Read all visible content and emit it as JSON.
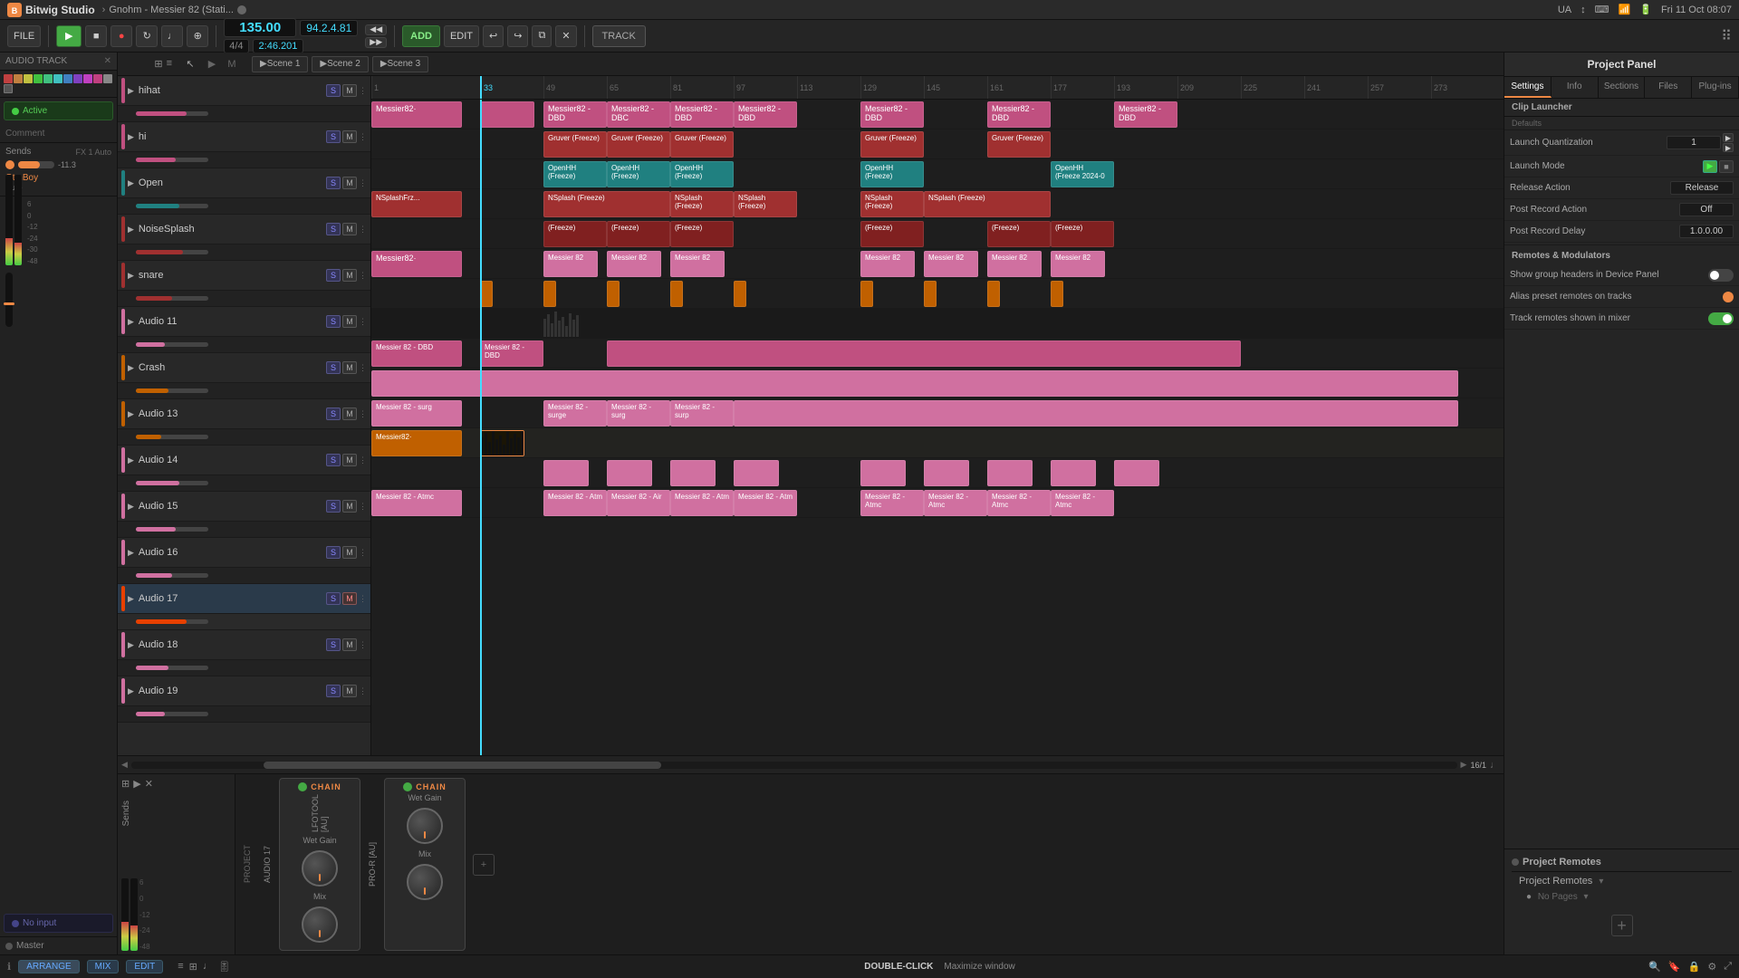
{
  "app": {
    "title": "Bitwig Studio",
    "file": "Gnohm - Messier 82 (Stati...",
    "time": "Fri 11 Oct  08:07"
  },
  "toolbar": {
    "file_label": "FILE",
    "play_label": "▶",
    "stop_label": "■",
    "record_label": "●",
    "tempo": "135.00",
    "position": "94.2.4.81",
    "time_display": "2:46.201",
    "signature": "4/4",
    "add_label": "ADD",
    "edit_label": "EDIT",
    "track_label": "TRACK"
  },
  "left_panel": {
    "track_label": "AUDIO TRACK",
    "track_number": "Audio 17",
    "active_label": "Active",
    "comment_label": "Comment",
    "plugins": [
      "LFOTool [AU]",
      "Pro-R [AU]"
    ],
    "no_input_label": "No input",
    "master_label": "Master"
  },
  "scenes": {
    "labels": [
      "Scene 1",
      "Scene 2",
      "Scene 3"
    ]
  },
  "tracks": [
    {
      "name": "hihat",
      "color": "#c05080",
      "s": true,
      "m": false
    },
    {
      "name": "hi",
      "color": "#c05080",
      "s": true,
      "m": false
    },
    {
      "name": "Open",
      "color": "#208080",
      "s": true,
      "m": false
    },
    {
      "name": "NoiseSplash",
      "color": "#a03030",
      "s": true,
      "m": false
    },
    {
      "name": "snare",
      "color": "#a03030",
      "s": true,
      "m": false
    },
    {
      "name": "Audio 11",
      "color": "#d070a0",
      "s": true,
      "m": false
    },
    {
      "name": "Crash",
      "color": "#c06000",
      "s": true,
      "m": false
    },
    {
      "name": "Audio 13",
      "color": "#c06000",
      "s": true,
      "m": false
    },
    {
      "name": "Audio 14",
      "color": "#d070a0",
      "s": true,
      "m": false
    },
    {
      "name": "Audio 15",
      "color": "#d070a0",
      "s": true,
      "m": false
    },
    {
      "name": "Audio 16",
      "color": "#d070a0",
      "s": true,
      "m": false
    },
    {
      "name": "Audio 17",
      "color": "#e84000",
      "s": true,
      "m": true
    },
    {
      "name": "Audio 18",
      "color": "#d070a0",
      "s": true,
      "m": false
    },
    {
      "name": "Audio 19",
      "color": "#d070a0",
      "s": true,
      "m": false
    }
  ],
  "ruler": {
    "marks": [
      "1",
      "33",
      "49",
      "65",
      "81",
      "97",
      "113",
      "129",
      "145",
      "161",
      "177",
      "193",
      "209",
      "225",
      "241",
      "257",
      "273"
    ],
    "playhead_pos": "33"
  },
  "right_panel": {
    "title": "Project Panel",
    "tabs": [
      "Settings",
      "Info",
      "Sections",
      "Files",
      "Plug-ins"
    ],
    "clip_launcher_label": "Clip Launcher",
    "defaults_label": "Defaults",
    "launch_quantization_label": "Launch Quantization",
    "launch_quantization_value": "1",
    "launch_mode_label": "Launch Mode",
    "release_action_label": "Release Action",
    "release_action_value": "Release",
    "post_record_action_label": "Post Record Action",
    "post_record_action_value": "Off",
    "post_record_delay_label": "Post Record Delay",
    "post_record_delay_value": "1.0.0.00",
    "remotes_modulators_label": "Remotes & Modulators",
    "show_group_headers_label": "Show group headers in Device Panel",
    "alias_preset_label": "Alias preset remotes on tracks",
    "track_remotes_mixer_label": "Track remotes shown in mixer",
    "project_remotes_title": "Project Remotes",
    "project_remotes_subtitle": "Project Remotes",
    "no_pages_label": "No Pages"
  },
  "mixer": {
    "chains": [
      {
        "label": "CHAIN",
        "track": "AUDIO 17",
        "plugin": "LFOTOOL [AU]",
        "knob1_label": "Wet Gain",
        "knob2_label": "Mix"
      },
      {
        "label": "CHAIN",
        "track": "AUDIO 17",
        "plugin": "PRO-R [AU]",
        "knob1_label": "Wet Gain",
        "knob2_label": "Mix"
      }
    ]
  },
  "statusbar": {
    "arrange_label": "ARRANGE",
    "mix_label": "MIX",
    "edit_label": "EDIT",
    "hint_bold": "DOUBLE-CLICK",
    "hint": "Maximize window"
  }
}
